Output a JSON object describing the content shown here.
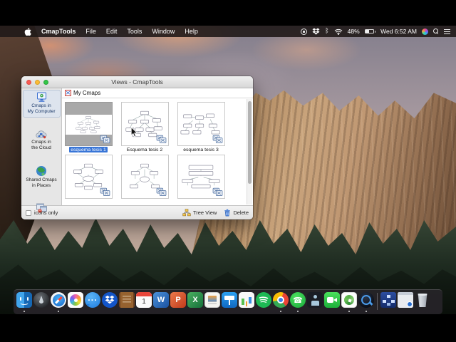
{
  "menu_bar": {
    "app_name": "CmapTools",
    "items": [
      "File",
      "Edit",
      "Tools",
      "Window",
      "Help"
    ],
    "status": {
      "battery": "48%",
      "clock": "Wed 6:52 AM"
    }
  },
  "window": {
    "title": "Views - CmapTools",
    "header": "My Cmaps",
    "sidebar": {
      "items": [
        {
          "label": "Cmaps in\nMy Computer",
          "icon": "computer-icon",
          "selected": true
        },
        {
          "label": "Cmaps in\nthe Cloud",
          "icon": "cloud-icon",
          "selected": false
        },
        {
          "label": "Shared Cmaps\nin Places",
          "icon": "globe-icon",
          "selected": false
        },
        {
          "label": "",
          "icon": "places-window-icon",
          "selected": false
        }
      ],
      "icons_only_label": "icons only"
    },
    "cmaps": [
      {
        "label": "esquema tesis 1",
        "selected": true
      },
      {
        "label": "Esquema tesis 2",
        "selected": false
      },
      {
        "label": "esquema tesis 3",
        "selected": false
      },
      {
        "label": "",
        "selected": false
      },
      {
        "label": "",
        "selected": false
      },
      {
        "label": "",
        "selected": false
      }
    ],
    "footer": {
      "tree_view": "Tree View",
      "delete": "Delete"
    }
  },
  "dock": {
    "glyphs": {
      "word": "W",
      "powerpoint": "P",
      "excel": "X",
      "calendar_day": "1"
    },
    "items": [
      "finder",
      "launchpad",
      "safari",
      "photos",
      "messages",
      "dropbox",
      "contacts",
      "calendar",
      "word",
      "powerpoint",
      "excel",
      "preview",
      "keynote",
      "numbers",
      "spotify",
      "chrome",
      "whatsapp",
      "kindle",
      "facetime",
      "cmaptools",
      "quicktime",
      "cmaptools-views",
      "minimized-window",
      "trash"
    ]
  },
  "colors": {
    "selection_blue": "#3875d7",
    "menubar_bg": "rgba(32,26,24,0.90)",
    "sidebar_selected_bg": "#dde4ee"
  }
}
